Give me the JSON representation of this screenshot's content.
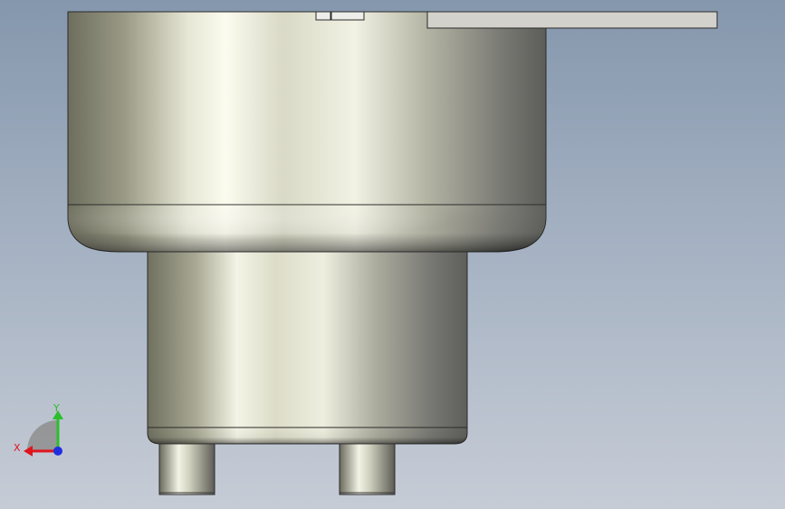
{
  "viewport": {
    "background_top": "#8597ad",
    "background_bottom": "#c6ccd6"
  },
  "triad": {
    "x_label": "X",
    "y_label": "Y",
    "x_color": "#e0141e",
    "y_color": "#2bbf2b",
    "z_color": "#1f2fe0"
  }
}
